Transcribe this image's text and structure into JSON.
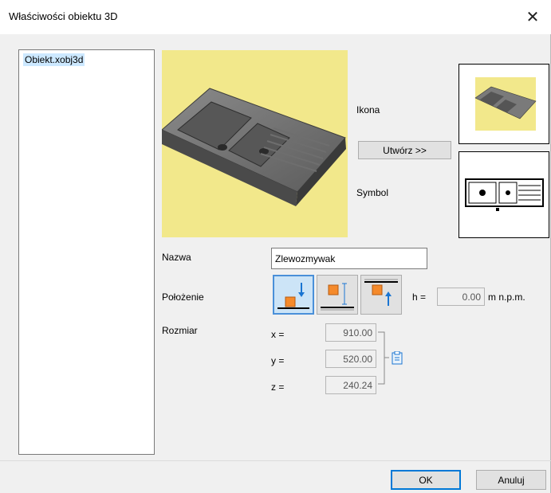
{
  "window": {
    "title": "Właściwości obiektu 3D"
  },
  "file_list": {
    "items": [
      {
        "label": "Obiekt.xobj3d",
        "selected": true
      }
    ]
  },
  "preview": {
    "background_color": "#f2e88b"
  },
  "icon_section": {
    "label": "Ikona"
  },
  "create_button": {
    "label": "Utwórz >>"
  },
  "symbol_section": {
    "label": "Symbol"
  },
  "name_field": {
    "label": "Nazwa",
    "value": "Zlewozmywak"
  },
  "position": {
    "label": "Położenie",
    "options": [
      "floor",
      "wall-mounted",
      "ceiling"
    ],
    "selected": "floor",
    "h_label": "h =",
    "h_value": "0.00",
    "h_unit": "m n.p.m."
  },
  "size": {
    "label": "Rozmiar",
    "x_label": "x =",
    "x_value": "910.00",
    "y_label": "y =",
    "y_value": "520.00",
    "z_label": "z =",
    "z_value": "240.24",
    "lock_icon": "clipboard-icon"
  },
  "footer": {
    "ok_label": "OK",
    "cancel_label": "Anuluj"
  },
  "colors": {
    "accent": "#0078d7",
    "selection": "#cce8ff",
    "marker": "#f58a2b"
  }
}
